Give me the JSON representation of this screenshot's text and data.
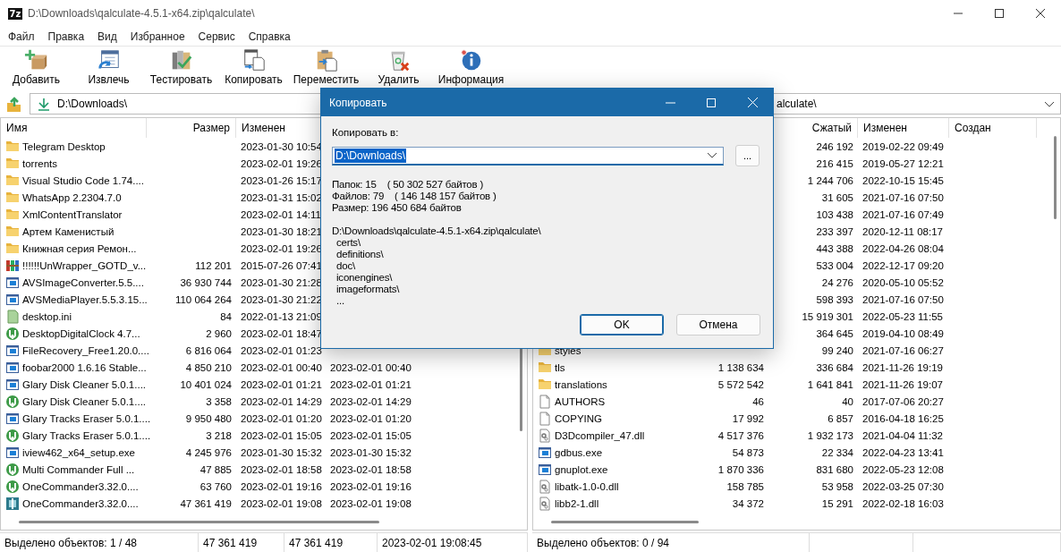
{
  "window": {
    "icon_text": "7z",
    "title": "D:\\Downloads\\qalculate-4.5.1-x64.zip\\qalculate\\"
  },
  "menu": [
    "Файл",
    "Правка",
    "Вид",
    "Избранное",
    "Сервис",
    "Справка"
  ],
  "toolbar": [
    {
      "kind": "add",
      "label": "Добавить"
    },
    {
      "kind": "extract",
      "label": "Извлечь"
    },
    {
      "kind": "test",
      "label": "Тестировать"
    },
    {
      "kind": "copy",
      "label": "Копировать"
    },
    {
      "kind": "move",
      "label": "Переместить"
    },
    {
      "kind": "delete",
      "label": "Удалить"
    },
    {
      "kind": "info",
      "label": "Информация"
    }
  ],
  "left_panel": {
    "address": "D:\\Downloads\\",
    "columns": [
      {
        "kind": "name",
        "label": "Имя"
      },
      {
        "kind": "size",
        "label": "Размер"
      },
      {
        "kind": "modified",
        "label": "Изменен"
      }
    ],
    "rows": [
      {
        "kind": "folder",
        "name": "Telegram Desktop",
        "modified": "2023-01-30 10:54"
      },
      {
        "kind": "folder",
        "name": "torrents",
        "modified": "2023-02-01 19:26"
      },
      {
        "kind": "folder",
        "name": "Visual Studio Code 1.74....",
        "modified": "2023-01-26 15:17"
      },
      {
        "kind": "folder",
        "name": "WhatsApp 2.2304.7.0",
        "modified": "2023-01-31 15:02"
      },
      {
        "kind": "folder",
        "name": "XmlContentTranslator",
        "modified": "2023-02-01 14:11"
      },
      {
        "kind": "folder",
        "name": "Артем Каменистый",
        "modified": "2023-01-30 18:21"
      },
      {
        "kind": "folder",
        "name": "Книжная серия Ремон...",
        "modified": "2023-02-01 19:26"
      },
      {
        "kind": "archive",
        "name": "!!!!!!UnWrapper_GOTD_v...",
        "size": "112 201",
        "modified": "2015-07-26 07:41"
      },
      {
        "kind": "exe",
        "name": "AVSImageConverter.5.5....",
        "size": "36 930 744",
        "modified": "2023-01-30 21:28"
      },
      {
        "kind": "exe",
        "name": "AVSMediaPlayer.5.5.3.15...",
        "size": "110 064 264",
        "modified": "2023-01-30 21:22"
      },
      {
        "kind": "ini",
        "name": "desktop.ini",
        "size": "84",
        "modified": "2022-01-13 21:09"
      },
      {
        "kind": "torrent",
        "name": "DesktopDigitalClock 4.7...",
        "size": "2 960",
        "modified": "2023-02-01 18:47"
      },
      {
        "kind": "exe",
        "name": "FileRecovery_Free1.20.0....",
        "size": "6 816 064",
        "modified": "2023-02-01 01:23"
      },
      {
        "kind": "exe",
        "name": "foobar2000 1.6.16 Stable...",
        "size": "4 850 210",
        "modified": "2023-02-01 00:40",
        "created": "2023-02-01 00:40"
      },
      {
        "kind": "exe",
        "name": "Glary Disk Cleaner 5.0.1....",
        "size": "10 401 024",
        "modified": "2023-02-01 01:21",
        "created": "2023-02-01 01:21"
      },
      {
        "kind": "torrent",
        "name": "Glary Disk Cleaner 5.0.1....",
        "size": "3 358",
        "modified": "2023-02-01 14:29",
        "created": "2023-02-01 14:29"
      },
      {
        "kind": "exe",
        "name": "Glary Tracks Eraser 5.0.1....",
        "size": "9 950 480",
        "modified": "2023-02-01 01:20",
        "created": "2023-02-01 01:20"
      },
      {
        "kind": "torrent",
        "name": "Glary Tracks Eraser 5.0.1....",
        "size": "3 218",
        "modified": "2023-02-01 15:05",
        "created": "2023-02-01 15:05"
      },
      {
        "kind": "exe",
        "name": "iview462_x64_setup.exe",
        "size": "4 245 976",
        "modified": "2023-01-30 15:32",
        "created": "2023-01-30 15:32"
      },
      {
        "kind": "torrent",
        "name": "Multi Commander Full ...",
        "size": "47 885",
        "modified": "2023-02-01 18:58",
        "created": "2023-02-01 18:58"
      },
      {
        "kind": "torrent",
        "name": "OneCommander3.32.0....",
        "size": "63 760",
        "modified": "2023-02-01 19:16",
        "created": "2023-02-01 19:16"
      },
      {
        "kind": "installer",
        "name": "OneCommander3.32.0....",
        "size": "47 361 419",
        "modified": "2023-02-01 19:08",
        "created": "2023-02-01 19:08"
      }
    ]
  },
  "right_panel": {
    "address": "alculate\\",
    "columns": [
      {
        "kind": "packed",
        "label": "Сжатый"
      },
      {
        "kind": "modified",
        "label": "Изменен"
      },
      {
        "kind": "created",
        "label": "Создан"
      }
    ],
    "rows": [
      {
        "packed": "246 192",
        "modified": "2019-02-22 09:49"
      },
      {
        "packed": "216 415",
        "modified": "2019-05-27 12:21"
      },
      {
        "packed": "1 244 706",
        "modified": "2022-10-15 15:45"
      },
      {
        "packed": "31 605",
        "modified": "2021-07-16 07:50"
      },
      {
        "packed": "103 438",
        "modified": "2021-07-16 07:49"
      },
      {
        "packed": "233 397",
        "modified": "2020-12-11 08:17"
      },
      {
        "packed": "443 388",
        "modified": "2022-04-26 08:04"
      },
      {
        "packed": "533 004",
        "modified": "2022-12-17 09:20"
      },
      {
        "packed": "24 276",
        "modified": "2020-05-10 05:52"
      },
      {
        "packed": "598 393",
        "modified": "2021-07-16 07:50"
      },
      {
        "packed": "15 919 301",
        "modified": "2022-05-23 11:55"
      },
      {
        "packed": "364 645",
        "modified": "2019-04-10 08:49"
      },
      {
        "kind": "folder",
        "name": "styles",
        "packed": "99 240",
        "modified": "2021-07-16 06:27"
      },
      {
        "kind": "folder",
        "name": "tls",
        "size": "1 138 634",
        "packed": "336 684",
        "modified": "2021-11-26 19:19"
      },
      {
        "kind": "folder",
        "name": "translations",
        "size": "5 572 542",
        "packed": "1 641 841",
        "modified": "2021-11-26 19:07"
      },
      {
        "kind": "file",
        "name": "AUTHORS",
        "size": "46",
        "packed": "40",
        "modified": "2017-07-06 20:27"
      },
      {
        "kind": "file",
        "name": "COPYING",
        "size": "17 992",
        "packed": "6 857",
        "modified": "2016-04-18 16:25"
      },
      {
        "kind": "dll",
        "name": "D3Dcompiler_47.dll",
        "size": "4 517 376",
        "packed": "1 932 173",
        "modified": "2021-04-04 11:32"
      },
      {
        "kind": "exe",
        "name": "gdbus.exe",
        "size": "54 873",
        "packed": "22 334",
        "modified": "2022-04-23 13:41"
      },
      {
        "kind": "exe",
        "name": "gnuplot.exe",
        "size": "1 870 336",
        "packed": "831 680",
        "modified": "2022-05-23 12:08"
      },
      {
        "kind": "dll",
        "name": "libatk-1.0-0.dll",
        "size": "158 785",
        "packed": "53 958",
        "modified": "2022-03-25 07:30"
      },
      {
        "kind": "dll",
        "name": "libb2-1.dll",
        "size": "34 372",
        "packed": "15 291",
        "modified": "2022-02-18 16:03"
      }
    ]
  },
  "status_bar": {
    "left": [
      "Выделено объектов: 1 / 48",
      "47 361 419",
      "47 361 419",
      "2023-02-01 19:08:45"
    ],
    "right": [
      "Выделено объектов: 0 / 94"
    ]
  },
  "dialog": {
    "title": "Копировать",
    "label": "Копировать в:",
    "value": "D:\\Downloads\\",
    "value_selected": true,
    "browse": "...",
    "info": [
      "Папок: 15    ( 50 302 527 байтов )",
      "Файлов: 79    ( 146 148 157 байтов )",
      "Размер: 196 450 684 байтов"
    ],
    "paths": {
      "path": "D:\\Downloads\\qalculate-4.5.1-x64.zip\\qalculate\\",
      "children": [
        "certs\\",
        "definitions\\",
        "doc\\",
        "iconengines\\",
        "imageformats\\",
        "..."
      ]
    },
    "buttons": [
      {
        "label": "OK",
        "default": true
      },
      {
        "label": "Отмена",
        "default": false
      }
    ]
  }
}
